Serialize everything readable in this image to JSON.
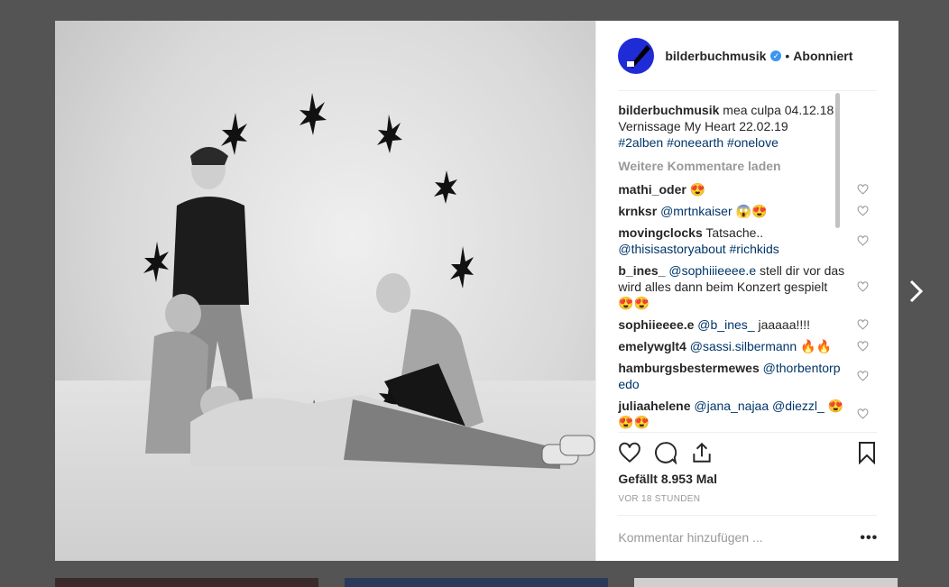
{
  "post": {
    "username": "bilderbuchmusik",
    "follow_status": "Abonniert",
    "separator": "•",
    "caption": {
      "user": "bilderbuchmusik",
      "text_parts": [
        "mea culpa 04.12.18 Vernissage My Heart 22.02.19"
      ],
      "hashtags": [
        "#2alben",
        "#oneearth",
        "#onelove"
      ]
    },
    "load_more": "Weitere Kommentare laden",
    "comments": [
      {
        "user": "mathi_oder",
        "text": "😍",
        "mention": ""
      },
      {
        "user": "krnksr",
        "mention": "@mrtnkaiser",
        "text": "😱😍"
      },
      {
        "user": "movingclocks",
        "text": "Tatsache..",
        "mention": "@thisisastoryabout #richkids"
      },
      {
        "user": "b_ines_",
        "mention": "@sophiiieeee.e",
        "text": "stell dir vor das wird alles dann beim Konzert gespielt 😍😍"
      },
      {
        "user": "sophiieeee.e",
        "mention": "@b_ines_",
        "text": "jaaaaa!!!!"
      },
      {
        "user": "emelywglt4",
        "mention": "@sassi.silbermann",
        "text": "🔥🔥"
      },
      {
        "user": "hamburgsbestermewes",
        "mention": "@thorbentorpedo",
        "text": ""
      },
      {
        "user": "juliaahelene",
        "mention": "@jana_najaa @diezzl_",
        "text": "😍😍😍"
      }
    ],
    "likes": "Gefällt 8.953 Mal",
    "time": "VOR 18 STUNDEN",
    "comment_placeholder": "Kommentar hinzufügen ...",
    "more_options": "•••"
  }
}
